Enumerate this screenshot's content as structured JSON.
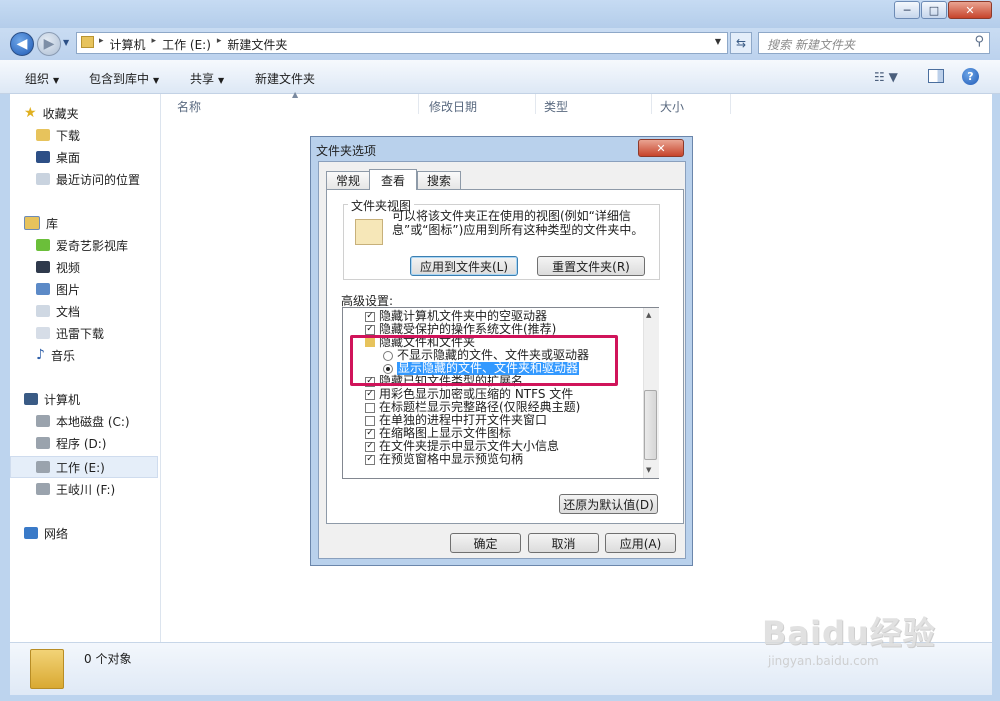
{
  "window": {
    "controls": {
      "minimize": "─",
      "maximize": "□",
      "close": "✕"
    }
  },
  "address": {
    "crumbs": [
      "计算机",
      "工作 (E:)",
      "新建文件夹"
    ],
    "separator": "▸",
    "search_placeholder": "搜索 新建文件夹"
  },
  "toolbar": {
    "organize": "组织",
    "include_library": "包含到库中",
    "share": "共享",
    "new_folder": "新建文件夹"
  },
  "nav": {
    "favorites": "收藏夹",
    "downloads": "下载",
    "desktop": "桌面",
    "recent": "最近访问的位置",
    "libraries": "库",
    "iqiyi": "爱奇艺影视库",
    "videos": "视频",
    "pictures": "图片",
    "documents": "文档",
    "thunder": "迅雷下载",
    "music": "音乐",
    "computer": "计算机",
    "drive_c": "本地磁盘 (C:)",
    "drive_d": "程序 (D:)",
    "drive_e": "工作 (E:)",
    "drive_f": "王岐川 (F:)",
    "network": "网络"
  },
  "columns": {
    "name": "名称",
    "modified": "修改日期",
    "type": "类型",
    "size": "大小"
  },
  "status": {
    "count": "0 个对象"
  },
  "dialog": {
    "title": "文件夹选项",
    "close": "✕",
    "tabs": {
      "general": "常规",
      "view": "查看",
      "search": "搜索"
    },
    "folder_views": {
      "title": "文件夹视图",
      "description": "可以将该文件夹正在使用的视图(例如“详细信息”或“图标”)应用到所有这种类型的文件夹中。",
      "apply_button": "应用到文件夹(L)",
      "reset_button": "重置文件夹(R)"
    },
    "advanced_label": "高级设置:",
    "settings": {
      "row0": "隐藏计算机文件夹中的空驱动器",
      "row1": "隐藏受保护的操作系统文件(推荐)",
      "row2": "隐藏文件和文件夹",
      "row3": "不显示隐藏的文件、文件夹或驱动器",
      "row4": "显示隐藏的文件、文件夹和驱动器",
      "row5": "隐藏已知文件类型的扩展名",
      "row6": "用彩色显示加密或压缩的 NTFS 文件",
      "row7": "在标题栏显示完整路径(仅限经典主题)",
      "row8": "在单独的进程中打开文件夹窗口",
      "row9": "在缩略图上显示文件图标",
      "row10": "在文件夹提示中显示文件大小信息",
      "row11": "在预览窗格中显示预览句柄"
    },
    "restore_defaults": "还原为默认值(D)",
    "ok": "确定",
    "cancel": "取消",
    "apply": "应用(A)"
  },
  "watermark": {
    "main": "Baidu经验",
    "sub": "jingyan.baidu.com"
  }
}
